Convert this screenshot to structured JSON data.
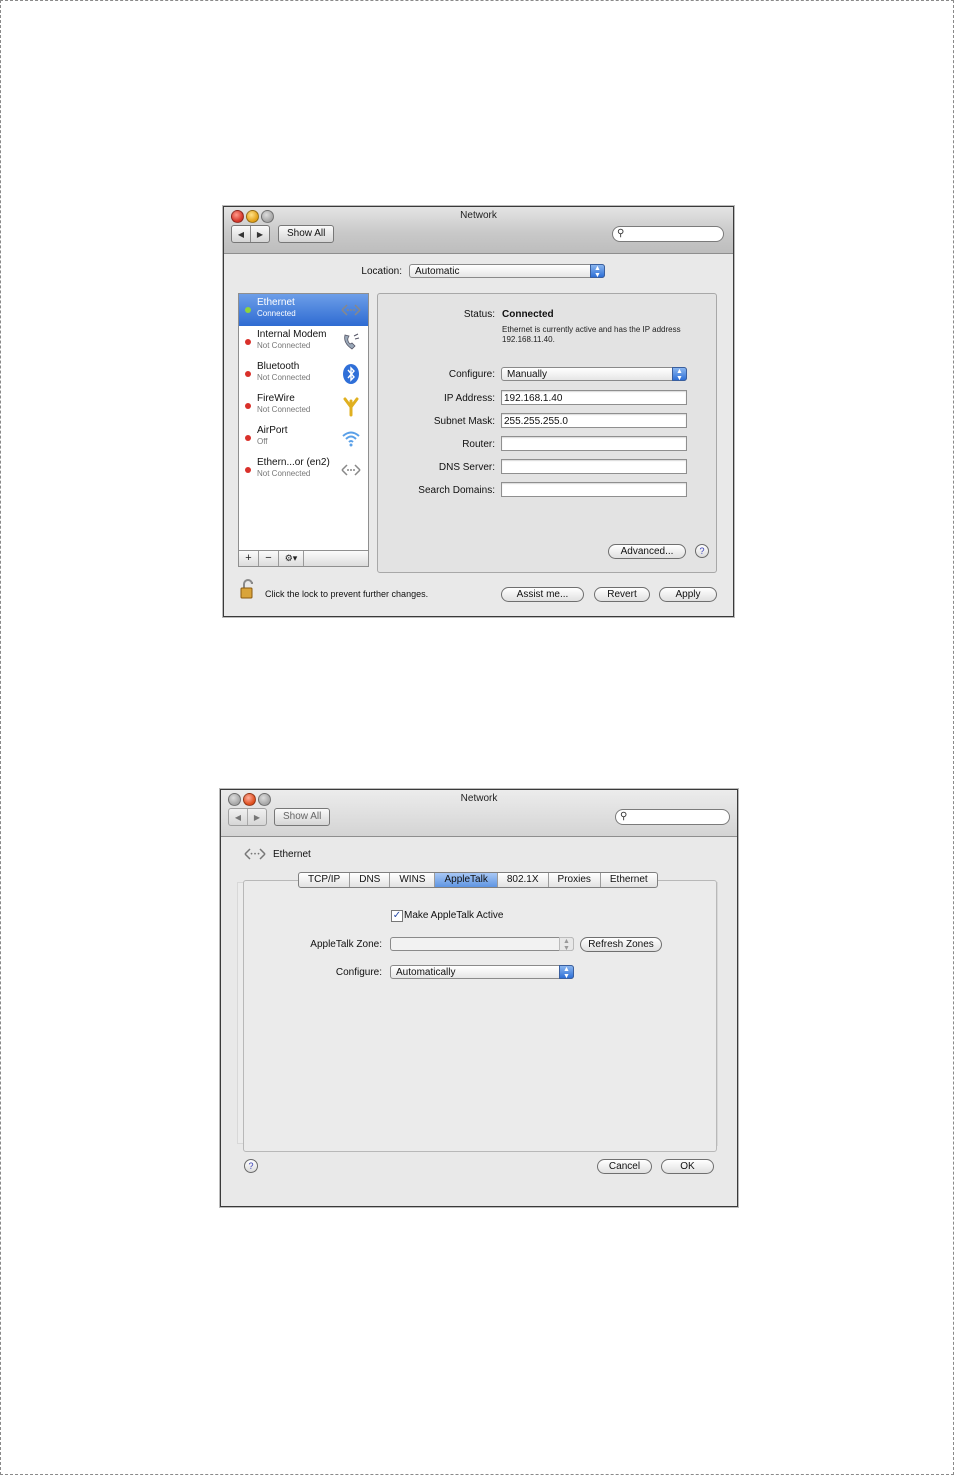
{
  "window1": {
    "title": "Network",
    "nav_back": "◀",
    "nav_forward": "▶",
    "show_all": "Show All",
    "location_label": "Location:",
    "location_value": "Automatic",
    "services": [
      {
        "name": "Ethernet",
        "status": "Connected",
        "dot": "#8fd33b",
        "icon": "ethernet-icon"
      },
      {
        "name": "Internal Modem",
        "status": "Not Connected",
        "dot": "#d9302a",
        "icon": "telephone-icon"
      },
      {
        "name": "Bluetooth",
        "status": "Not Connected",
        "dot": "#d9302a",
        "icon": "bluetooth-icon"
      },
      {
        "name": "FireWire",
        "status": "Not Connected",
        "dot": "#d9302a",
        "icon": "firewire-icon"
      },
      {
        "name": "AirPort",
        "status": "Off",
        "dot": "#d9302a",
        "icon": "wifi-icon"
      },
      {
        "name": "Ethern...or (en2)",
        "status": "Not Connected",
        "dot": "#d9302a",
        "icon": "ethernet-icon"
      }
    ],
    "sidebar_add": "+",
    "sidebar_remove": "−",
    "sidebar_gear": "⚙▾",
    "status_label": "Status:",
    "status_value": "Connected",
    "status_description": "Ethernet is currently active and has the IP address 192.168.11.40.",
    "configure_label": "Configure:",
    "configure_value": "Manually",
    "ip_label": "IP Address:",
    "ip_value": "192.168.1.40",
    "subnet_label": "Subnet Mask:",
    "subnet_value": "255.255.255.0",
    "router_label": "Router:",
    "router_value": "",
    "dns_label": "DNS Server:",
    "dns_value": "",
    "search_domains_label": "Search Domains:",
    "search_domains_value": "",
    "advanced_button": "Advanced...",
    "help": "?",
    "lock_text": "Click the lock to prevent further changes.",
    "assist_button": "Assist me...",
    "revert_button": "Revert",
    "apply_button": "Apply"
  },
  "window2": {
    "title": "Network",
    "nav_back": "◀",
    "nav_forward": "▶",
    "show_all": "Show All",
    "service_name": "Ethernet",
    "tabs": [
      "TCP/IP",
      "DNS",
      "WINS",
      "AppleTalk",
      "802.1X",
      "Proxies",
      "Ethernet"
    ],
    "active_tab": "AppleTalk",
    "make_active_label": "Make AppleTalk Active",
    "make_active_checked": true,
    "zone_label": "AppleTalk Zone:",
    "zone_value": "",
    "refresh_zones_button": "Refresh Zones",
    "configure_label": "Configure:",
    "configure_value": "Automatically",
    "help": "?",
    "cancel_button": "Cancel",
    "ok_button": "OK"
  },
  "colors": {
    "selection_blue": "#3f7bd9",
    "status_green": "#8fd33b",
    "status_red": "#d9302a"
  }
}
